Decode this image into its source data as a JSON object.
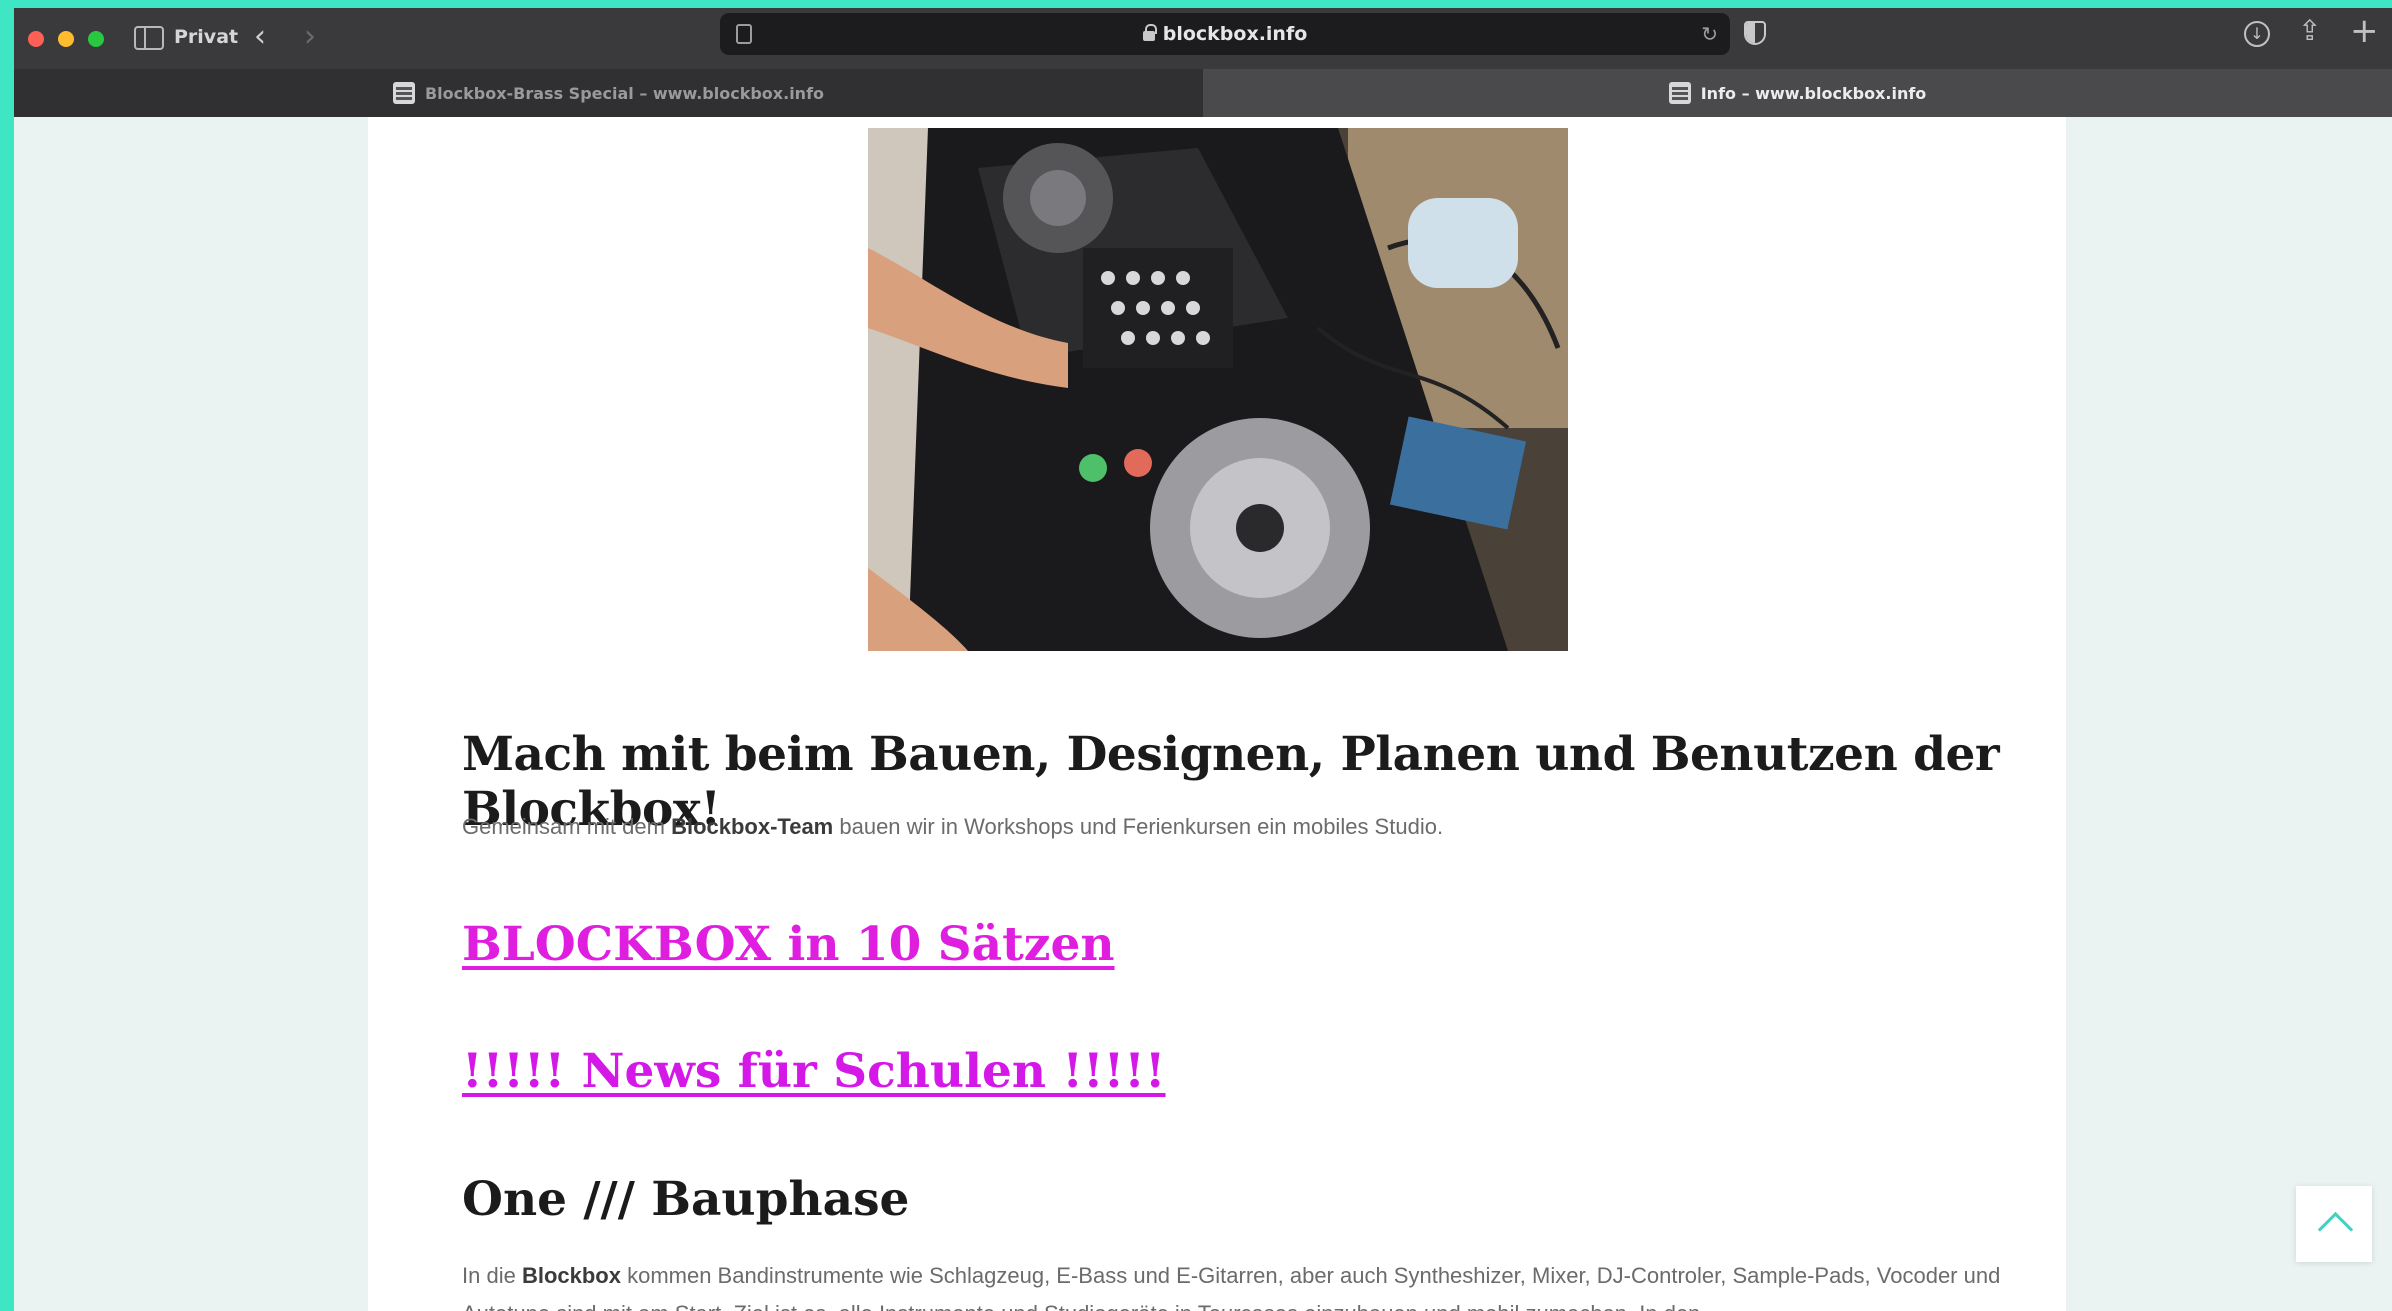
{
  "browser": {
    "mode_label": "Privat",
    "address": "blockbox.info",
    "tabs": [
      {
        "title": "Blockbox-Brass Special – www.blockbox.info",
        "active": false
      },
      {
        "title": "Info – www.blockbox.info",
        "active": true
      }
    ]
  },
  "content": {
    "headline": "Mach mit beim Bauen, Designen, Planen und Benutzen der Blockbox!",
    "intro": {
      "before": "Gemeinsam mit dem ",
      "strong": "Blockbox-Team",
      "after": " bauen wir in Workshops und Ferienkursen ein mobiles Studio."
    },
    "link_sentences": "BLOCKBOX in 10 Sätzen",
    "link_news": "!!!!! News für Schulen !!!!!",
    "section_title": "One /// Bauphase",
    "section_text": {
      "before": "In die ",
      "strong": "Blockbox",
      "after": " kommen Bandinstrumente wie Schlagzeug, E-Bass und E-Gitarren, aber auch Syntheshizer, Mixer, DJ-Controler, Sample-Pads, Vocoder und Autotune sind mit am Start. Ziel ist es, alle Instrumente und Studiogeräte in Tourcases einzubauen und mobil zumachen. In den"
    }
  },
  "colors": {
    "frame_accent": "#3ee6c4",
    "link_color": "#e01ee0",
    "scroll_top_arrow": "#3ed2c0"
  }
}
